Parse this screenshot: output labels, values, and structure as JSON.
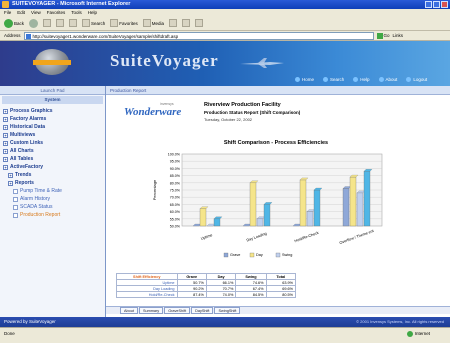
{
  "window": {
    "title": "SUITEVOYAGER - Microsoft Internet Explorer"
  },
  "menu": [
    "File",
    "Edit",
    "View",
    "Favorites",
    "Tools",
    "Help"
  ],
  "toolbar": {
    "back": "Back",
    "search": "Search",
    "favorites": "Favorites",
    "media": "Media"
  },
  "address": {
    "label": "Address",
    "url": "http://suitevoyager1.wonderware.com/SuiteVoyager/sample/shiftdraft.asp",
    "go": "Go",
    "links": "Links"
  },
  "banner": {
    "brand": "SuiteVoyager",
    "nav": [
      "Home",
      "Search",
      "Help",
      "About",
      "Logout"
    ]
  },
  "sidebar": {
    "header": "Launch Pad",
    "section": "System",
    "items": [
      {
        "label": "Process Graphics",
        "level": 0
      },
      {
        "label": "Factory Alarms",
        "level": 0
      },
      {
        "label": "Historical Data",
        "level": 0
      },
      {
        "label": "Multiviews",
        "level": 0
      },
      {
        "label": "Custom Links",
        "level": 0
      },
      {
        "label": "All Charts",
        "level": 0
      },
      {
        "label": "All Tables",
        "level": 0
      },
      {
        "label": "ActiveFactory",
        "level": 0
      },
      {
        "label": "Trends",
        "level": 1
      },
      {
        "label": "Reports",
        "level": 1
      },
      {
        "label": "Pump Time & Rate",
        "level": 2
      },
      {
        "label": "Alarm History",
        "level": 2
      },
      {
        "label": "SCADA Status",
        "level": 2
      },
      {
        "label": "Production Report",
        "level": 2,
        "active": true
      }
    ]
  },
  "main": {
    "breadcrumb": "Production Report",
    "vendor": "Wonderware",
    "vendor_small": "invensys",
    "facility": "Riverview Production Facility",
    "report_title": "Production Status Report (Shift Comparison)",
    "report_date": "Tuesday, October 22, 2002"
  },
  "chart_data": {
    "type": "bar",
    "title": "Shift Comparison - Process Efficiencies",
    "ylabel": "Percentage",
    "ylim": [
      0,
      100
    ],
    "yticks": [
      "100.0%",
      "95.0%",
      "90.0%",
      "85.0%",
      "80.0%",
      "75.0%",
      "70.0%",
      "65.0%",
      "60.0%",
      "55.0%",
      "50.0%"
    ],
    "categories": [
      "Uptime",
      "Day Loading",
      "Hold/Re-Check",
      "Overflow / Theme ent"
    ],
    "series": [
      {
        "name": "Grave",
        "color": "#8fa8d8",
        "values": [
          40,
          38,
          45,
          76
        ]
      },
      {
        "name": "Day",
        "color": "#f5e58a",
        "values": [
          62,
          80,
          82,
          84
        ]
      },
      {
        "name": "Swing",
        "color": "#c0d0ee",
        "values": [
          35,
          55,
          60,
          73
        ]
      },
      {
        "name": "Total",
        "color": "#4fb6e6",
        "values": [
          55,
          65,
          75,
          88
        ]
      }
    ],
    "legend": [
      "Grave",
      "Day",
      "Swing"
    ]
  },
  "table": {
    "header_label": "Shift Efficiency",
    "columns": [
      "Grave",
      "Day",
      "Swing",
      "Total"
    ],
    "rows": [
      {
        "label": "Uptime",
        "values": [
          "50.7%",
          "66.1%",
          "74.6%",
          "63.9%"
        ]
      },
      {
        "label": "Day Loading",
        "values": [
          "90.2%",
          "70.7%",
          "67.4%",
          "69.6%"
        ]
      },
      {
        "label": "Hold/Re-Check",
        "values": [
          "87.4%",
          "74.0%",
          "84.5%",
          "80.5%"
        ]
      }
    ]
  },
  "tabs": [
    "About",
    "Summary",
    "GraveShift",
    "DayShift",
    "SwingShift"
  ],
  "status": {
    "powered": "Powered by SuiteVoyager",
    "copyright": "© 2001 Invensys Systems, Inc. All rights reserved"
  },
  "ie": {
    "done": "Done",
    "zone": "Internet"
  }
}
